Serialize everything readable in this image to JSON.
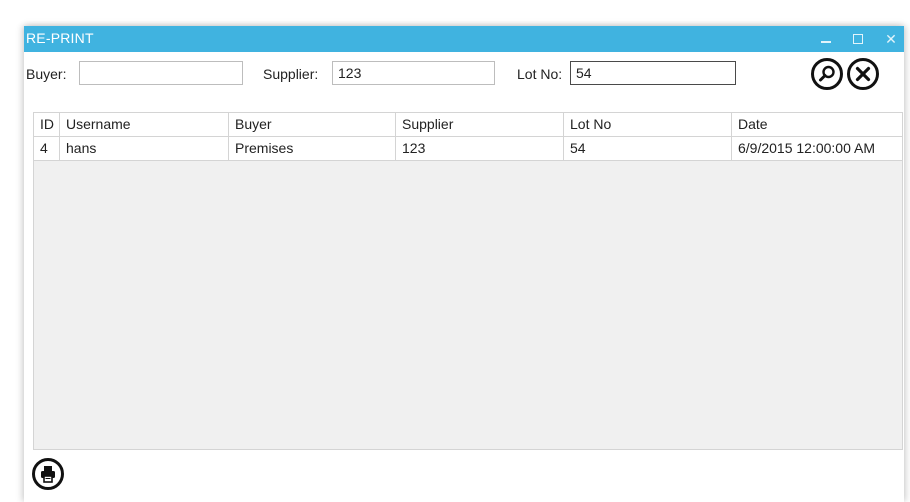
{
  "window": {
    "title": "RE-PRINT",
    "controls": {
      "minimize": "–",
      "maximize": "□",
      "close": "✕"
    }
  },
  "filters": {
    "buyer": {
      "label": "Buyer:",
      "value": ""
    },
    "supplier": {
      "label": "Supplier:",
      "value": "123"
    },
    "lot_no": {
      "label": "Lot No:",
      "value": "54"
    }
  },
  "toolbar": {
    "search_icon": "search-icon",
    "cancel_icon": "close-icon"
  },
  "table": {
    "columns": [
      "ID",
      "Username",
      "Buyer",
      "Supplier",
      "Lot No",
      "Date"
    ],
    "rows": [
      [
        "4",
        "hans",
        "Premises",
        "123",
        "54",
        "6/9/2015 12:00:00 AM"
      ]
    ]
  },
  "footer": {
    "print_icon": "printer-icon"
  },
  "colors": {
    "titlebar": "#40b3e0",
    "grid_background": "#f0f0f0"
  }
}
